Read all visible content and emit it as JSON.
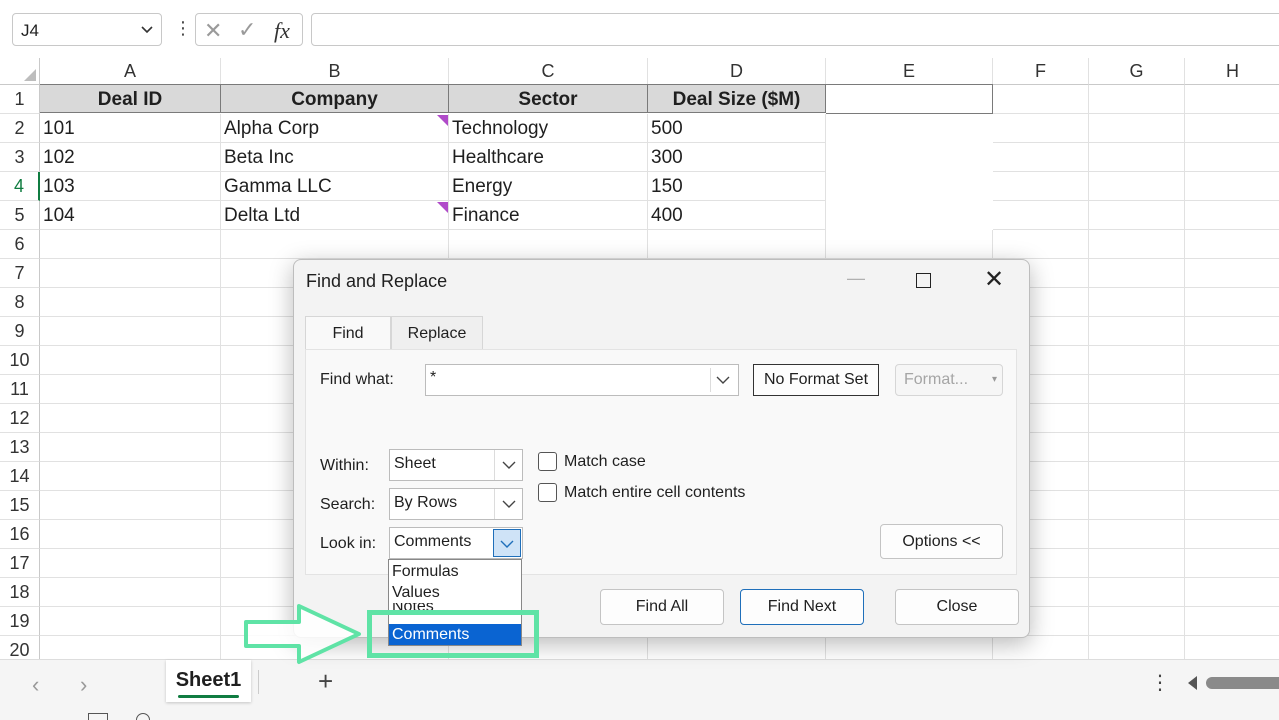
{
  "formula_bar": {
    "name_box": "J4",
    "fx": "fx",
    "formula": ""
  },
  "columns": [
    "A",
    "B",
    "C",
    "D",
    "E",
    "F",
    "G",
    "H"
  ],
  "rows": [
    "1",
    "2",
    "3",
    "4",
    "5",
    "6",
    "7",
    "8",
    "9",
    "10",
    "11",
    "12",
    "13",
    "14",
    "15",
    "16",
    "17",
    "18",
    "19",
    "20"
  ],
  "active_row": "4",
  "table": {
    "headers": [
      "Deal ID",
      "Company",
      "Sector",
      "Deal Size ($M)"
    ],
    "rows": [
      [
        "101",
        "Alpha Corp",
        "Technology",
        "500"
      ],
      [
        "102",
        "Beta Inc",
        "Healthcare",
        "300"
      ],
      [
        "103",
        "Gamma LLC",
        "Energy",
        "150"
      ],
      [
        "104",
        "Delta Ltd",
        "Finance",
        "400"
      ]
    ]
  },
  "sheet_tabs": {
    "active": "Sheet1"
  },
  "dialog": {
    "title": "Find and Replace",
    "tabs": {
      "find": "Find",
      "replace": "Replace"
    },
    "find_what_label": "Find what:",
    "find_what_value": "*",
    "no_format_set": "No Format Set",
    "format_button": "Format...",
    "within_label": "Within:",
    "within_value": "Sheet",
    "search_label": "Search:",
    "search_value": "By Rows",
    "look_in_label": "Look in:",
    "look_in_value": "Comments",
    "match_case": "Match case",
    "match_entire": "Match entire cell contents",
    "options_button": "Options <<",
    "find_all": "Find All",
    "find_next": "Find Next",
    "close": "Close",
    "look_in_options": [
      "Formulas",
      "Values",
      "Notes",
      "Comments"
    ],
    "look_in_selected": "Comments"
  },
  "colors": {
    "accent_green": "#107c41",
    "note_marker": "#b04bc9",
    "highlight": "#5fe3a6",
    "selection_blue": "#0a64d2"
  }
}
